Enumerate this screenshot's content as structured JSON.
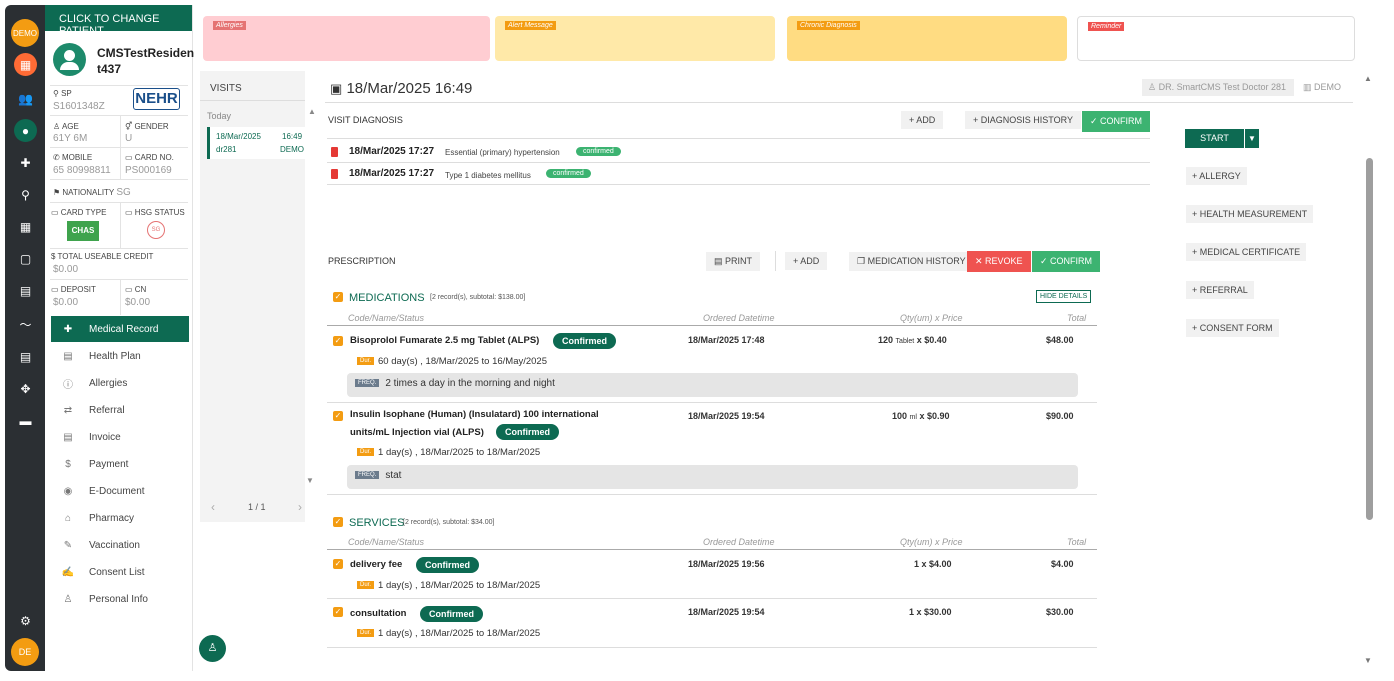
{
  "rail": {
    "demo_label": "DEMO",
    "user_initials": "DE"
  },
  "patient": {
    "change_label": "CLICK TO CHANGE PATIENT",
    "name": "CMSTestResiden t437",
    "sp_label": "SP",
    "sp_value": "S1601348Z",
    "nehr": "NEHR",
    "age_label": "AGE",
    "age_value": "61Y 6M",
    "gender_label": "GENDER",
    "gender_value": "U",
    "mobile_label": "MOBILE",
    "mobile_value": "65 80998811",
    "card_label": "CARD NO.",
    "card_value": "PS000169",
    "nationality_label": "NATIONALITY",
    "nationality_value": "SG",
    "card_type_label": "CARD TYPE",
    "card_type_value": "CHAS",
    "hsg_label": "HSG STATUS",
    "credit_label": "TOTAL USEABLE CREDIT",
    "credit_value": "$0.00",
    "deposit_label": "DEPOSIT",
    "deposit_value": "$0.00",
    "cn_label": "CN",
    "cn_value": "$0.00"
  },
  "menu": [
    {
      "label": "Medical Record",
      "icon": "plus-square-icon"
    },
    {
      "label": "Health Plan",
      "icon": "list-icon"
    },
    {
      "label": "Allergies",
      "icon": "info-icon"
    },
    {
      "label": "Referral",
      "icon": "referral-icon"
    },
    {
      "label": "Invoice",
      "icon": "invoice-icon"
    },
    {
      "label": "Payment",
      "icon": "dollar-icon"
    },
    {
      "label": "E-Document",
      "icon": "eye-icon"
    },
    {
      "label": "Pharmacy",
      "icon": "home-icon"
    },
    {
      "label": "Vaccination",
      "icon": "syringe-icon"
    },
    {
      "label": "Consent List",
      "icon": "signature-icon"
    },
    {
      "label": "Personal Info",
      "icon": "person-icon"
    }
  ],
  "alerts": {
    "allergies": "Allergies",
    "alert_message": "Alert Message",
    "chronic": "Chronic Diagnosis",
    "reminder": "Reminder"
  },
  "visits": {
    "title": "VISITS",
    "group": "Today",
    "date": "18/Mar/2025",
    "time": "16:49",
    "doctor": "dr281",
    "clinic": "DEMO",
    "page": "1 / 1"
  },
  "visit": {
    "datetime": "18/Mar/2025 16:49",
    "doctor": "DR. SmartCMS Test Doctor 281",
    "clinic": "DEMO"
  },
  "diagnosis": {
    "title": "VISIT DIAGNOSIS",
    "add": "+ ADD",
    "history": "+ DIAGNOSIS HISTORY",
    "confirm": "✓ CONFIRM",
    "items": [
      {
        "date": "18/Mar/2025 17:27",
        "desc": "Essential (primary) hypertension",
        "status": "confirmed"
      },
      {
        "date": "18/Mar/2025 17:27",
        "desc": "Type 1 diabetes mellitus",
        "status": "confirmed"
      }
    ]
  },
  "prescription": {
    "title": "PRESCRIPTION",
    "print": "PRINT",
    "add": "+ ADD",
    "history": "MEDICATION HISTORY",
    "revoke": "✕ REVOKE",
    "confirm": "✓ CONFIRM"
  },
  "medications": {
    "title": "MEDICATIONS",
    "summary": "[2 record(s), subtotal: $138.00]",
    "hide": "HIDE DETAILS",
    "cols": {
      "code": "Code/Name/Status",
      "ordered": "Ordered Datetime",
      "qty": "Qty(um) x Price",
      "total": "Total"
    },
    "dur_tag": "Dur.",
    "freq_tag": "FREQ.",
    "items": [
      {
        "name": "Bisoprolol Fumarate 2.5 mg Tablet (ALPS)",
        "status": "Confirmed",
        "ordered": "18/Mar/2025 17:48",
        "qty": "120",
        "unit": "Tablet",
        "price": "x $0.40",
        "total": "$48.00",
        "duration": "60 day(s) , 18/Mar/2025 to 16/May/2025",
        "freq": "2 times a day in the morning and night"
      },
      {
        "name_line1": "Insulin Isophane (Human) (Insulatard) 100 international",
        "name_line2": "units/mL Injection vial (ALPS)",
        "status": "Confirmed",
        "ordered": "18/Mar/2025 19:54",
        "qty": "100",
        "unit": "ml",
        "price": "x $0.90",
        "total": "$90.00",
        "duration": "1 day(s) , 18/Mar/2025 to 18/Mar/2025",
        "freq": "stat"
      }
    ]
  },
  "services": {
    "title": "SERVICES",
    "summary": "[2 record(s), subtotal: $34.00]",
    "items": [
      {
        "name": "delivery fee",
        "status": "Confirmed",
        "ordered": "18/Mar/2025 19:56",
        "qty": "1 x $4.00",
        "total": "$4.00",
        "duration": "1 day(s) , 18/Mar/2025 to 18/Mar/2025"
      },
      {
        "name": "consultation",
        "status": "Confirmed",
        "ordered": "18/Mar/2025 19:54",
        "qty": "1 x $30.00",
        "total": "$30.00",
        "duration": "1 day(s) , 18/Mar/2025 to 18/Mar/2025"
      }
    ]
  },
  "side": {
    "start": "START",
    "allergy": "+ ALLERGY",
    "health": "+ HEALTH MEASUREMENT",
    "mc": "+ MEDICAL CERTIFICATE",
    "referral": "+ REFERRAL",
    "consent": "+ CONSENT FORM"
  },
  "colors": {
    "brand": "#0d6a52",
    "green": "#3cb371",
    "orange": "#f39c12",
    "red": "#ef5350",
    "allergy_bg": "#ffcdd2",
    "alert_bg": "#ffe9a8",
    "chronic_bg": "#ffdc82"
  }
}
